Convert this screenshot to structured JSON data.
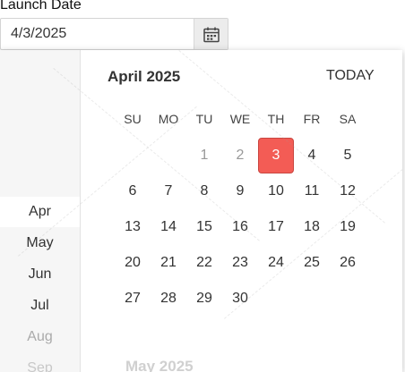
{
  "field": {
    "label": "Launch Date",
    "value": "4/3/2025"
  },
  "calendar": {
    "title": "April 2025",
    "today_label": "TODAY",
    "weekdays": [
      "SU",
      "MO",
      "TU",
      "WE",
      "TH",
      "FR",
      "SA"
    ],
    "days": [
      [
        "",
        "",
        "1",
        "2",
        "3",
        "4",
        "5"
      ],
      [
        "6",
        "7",
        "8",
        "9",
        "10",
        "11",
        "12"
      ],
      [
        "13",
        "14",
        "15",
        "16",
        "17",
        "18",
        "19"
      ],
      [
        "20",
        "21",
        "22",
        "23",
        "24",
        "25",
        "26"
      ],
      [
        "27",
        "28",
        "29",
        "30"
      ]
    ],
    "selected_day": "3",
    "next_title": "May 2025"
  },
  "months": [
    "Apr",
    "May",
    "Jun",
    "Jul",
    "Aug",
    "Sep"
  ],
  "colors": {
    "selected": "#f35c55"
  }
}
